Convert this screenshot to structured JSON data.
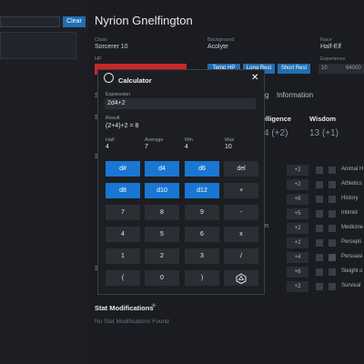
{
  "left_panel": {
    "clear_label": "Clear"
  },
  "character": {
    "name": "Nyrion Gnelfington",
    "class_label": "Class",
    "class_value": "Sorcerer 10",
    "background_label": "Background",
    "background_value": "Acolyte",
    "race_label": "Race",
    "race_value": "Half-Elf",
    "hp_label": "HP",
    "temp_hp_label": "Temp HP",
    "long_rest_label": "Long Rest",
    "short_rest_label": "Short Rest",
    "experience_label": "Experience",
    "experience_value": "10",
    "experience_partial": "64000"
  },
  "tabs": {
    "partial": "g",
    "information": "Information"
  },
  "abilities": [
    {
      "name": "Intelligence",
      "partial_name": "elligence",
      "value": "(+2)",
      "partial_value": "4 (+2)"
    },
    {
      "name": "Wisdom",
      "value": "13 (+1)"
    }
  ],
  "skills": [
    {
      "mod": "+2",
      "name": "Animal H"
    },
    {
      "mod": "+2",
      "name": "Athletics"
    },
    {
      "mod": "+8",
      "name": "History"
    },
    {
      "mod": "+5",
      "name": "Intimid"
    },
    {
      "mod": "+2",
      "name": "Medicine"
    },
    {
      "mod": "+2",
      "name": "Percepti"
    },
    {
      "mod": "+4",
      "name": "Persuasi"
    },
    {
      "mod": "+6",
      "name": "Sleight o"
    },
    {
      "mod": "+2",
      "name": "Survival"
    }
  ],
  "sheet_letters": {
    "s1": "S",
    "s2": "S",
    "s3": "S",
    "s4": "S",
    "n": "n"
  },
  "stat_mods": {
    "title": "Stat Modifications",
    "empty": "No Stat Modifications Found"
  },
  "calculator": {
    "title": "Calculator",
    "expression_label": "Expression",
    "expression_value": "2d4+2",
    "result_label": "Result",
    "result_value": "(2+4)+2 = 8",
    "stats": [
      {
        "label": "Half",
        "value": "4"
      },
      {
        "label": "Average",
        "value": "7"
      },
      {
        "label": "Min",
        "value": "4"
      },
      {
        "label": "Max",
        "value": "10"
      }
    ],
    "keys": [
      [
        "d#",
        "d4",
        "d6",
        "del"
      ],
      [
        "d8",
        "d10",
        "d12",
        "+"
      ],
      [
        "7",
        "8",
        "9",
        "-"
      ],
      [
        "4",
        "5",
        "6",
        "x"
      ],
      [
        "1",
        "2",
        "3",
        "/"
      ],
      [
        "(",
        "0",
        ")",
        "⬡"
      ]
    ]
  },
  "colors": {
    "accent": "#1976d2",
    "hp": "#c62828",
    "bg": "#1a1c21"
  }
}
